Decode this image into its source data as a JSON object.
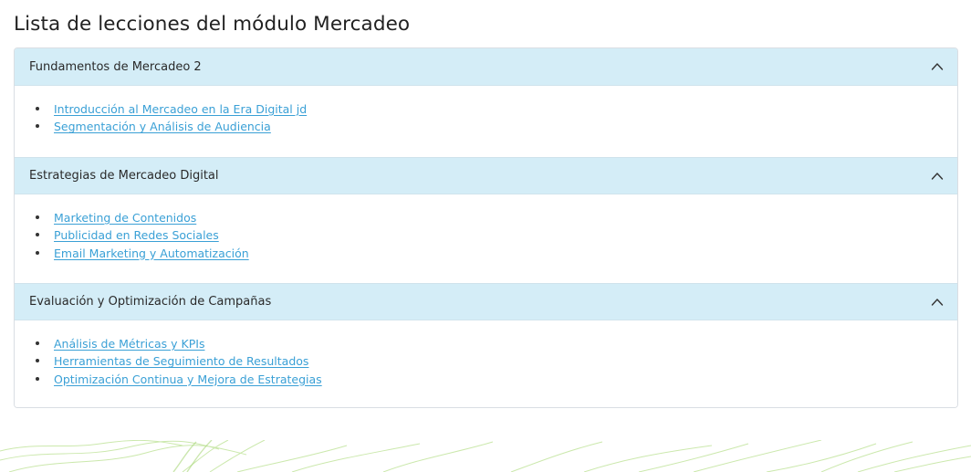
{
  "page": {
    "title": "Lista de lecciones del módulo Mercadeo"
  },
  "colors": {
    "header_bg": "#d4edf7",
    "link": "#3aa0d6",
    "decoration": "#b9de8e"
  },
  "sections": [
    {
      "title": "Fundamentos de Mercadeo 2",
      "expanded_icon": "chevron-up-icon",
      "lessons": [
        "Introducción al Mercadeo en la Era Digital jd",
        "Segmentación y Análisis de Audiencia"
      ]
    },
    {
      "title": "Estrategias de Mercadeo Digital",
      "expanded_icon": "chevron-up-icon",
      "lessons": [
        "Marketing de Contenidos",
        "Publicidad en Redes Sociales",
        "Email Marketing y Automatización"
      ]
    },
    {
      "title": "Evaluación y Optimización de Campañas",
      "expanded_icon": "chevron-up-icon",
      "lessons": [
        "Análisis de Métricas y KPIs",
        "Herramientas de Seguimiento de Resultados",
        "Optimización Continua y Mejora de Estrategias"
      ]
    }
  ]
}
